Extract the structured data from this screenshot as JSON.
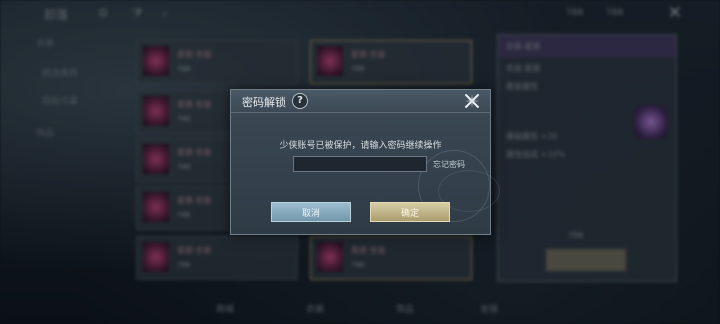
{
  "background": {
    "title": "卸落",
    "left_nav": [
      "衣装",
      "精选推荐",
      "搭配方案",
      "饰品"
    ],
    "item_name": "星辰·衣装",
    "price": "788",
    "bottom_tabs": [
      "商城",
      "衣装",
      "饰品",
      "坐骑"
    ],
    "panel_title": "衣装·星辰",
    "panel_lines": [
      "衣装·星辰",
      "套装属性",
      "基础属性 +20",
      "属性加成 +10%"
    ]
  },
  "dialog": {
    "title": "密码解锁",
    "help_icon": "?",
    "close_icon": "close-x-icon",
    "message": "少侠账号已被保护，请输入密码继续操作",
    "password_value": "",
    "password_placeholder": "",
    "forgot_label": "忘记密码",
    "cancel_label": "取消",
    "ok_label": "确定"
  },
  "colors": {
    "cancel_button": "#8fb2c6",
    "ok_button": "#c6bb8e",
    "dialog_bg": "#34414c"
  }
}
